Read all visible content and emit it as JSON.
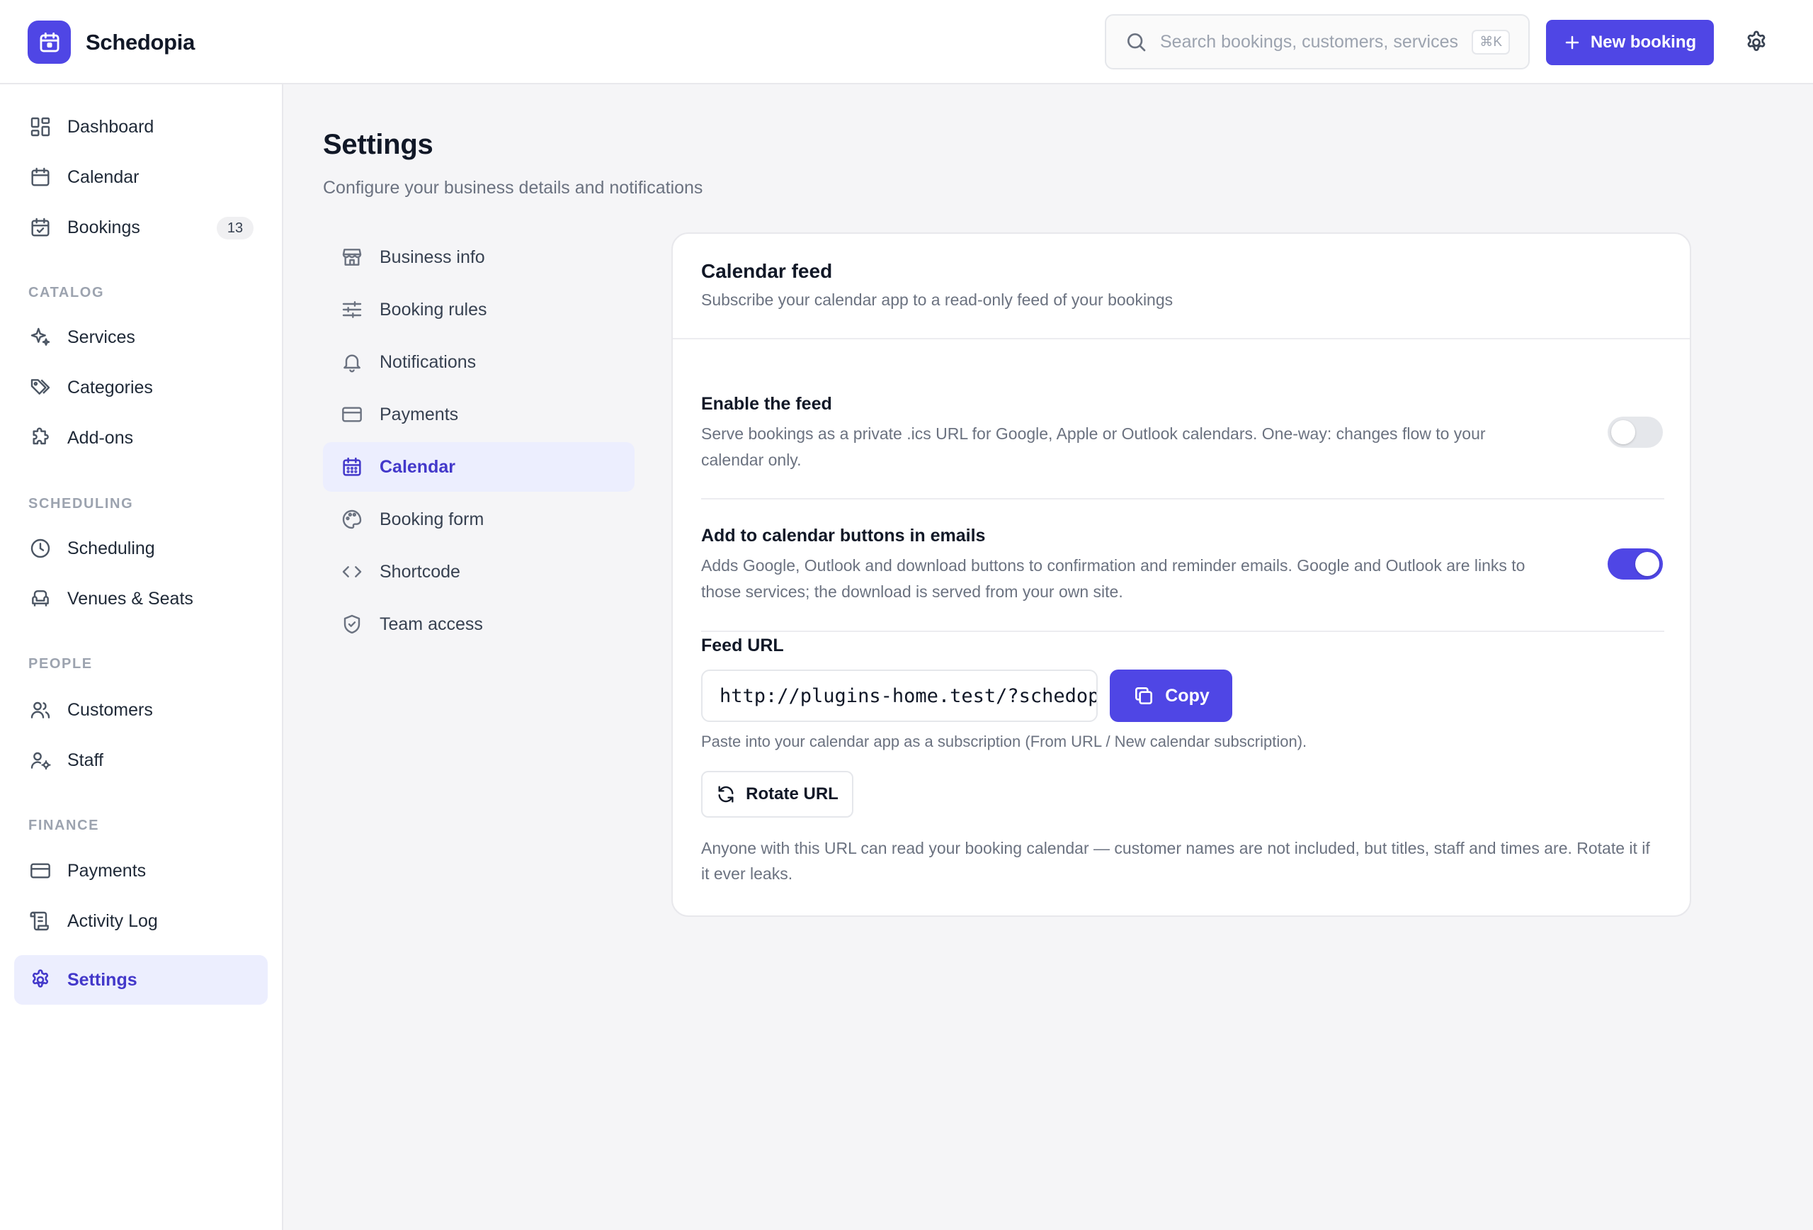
{
  "app": {
    "name": "Schedopia",
    "logo_icon": "calendar-icon"
  },
  "topbar": {
    "search_placeholder": "Search bookings, customers, services",
    "search_shortcut": "⌘K",
    "new_booking_label": "New booking",
    "settings_icon": "gear-icon"
  },
  "sidebar": {
    "items": [
      {
        "label": "Dashboard",
        "icon": "dashboard-icon"
      },
      {
        "label": "Calendar",
        "icon": "calendar-icon"
      },
      {
        "label": "Bookings",
        "icon": "calendar-check-icon",
        "badge": "13"
      }
    ],
    "sections": [
      {
        "title": "CATALOG",
        "items": [
          {
            "label": "Services",
            "icon": "sparkle-icon"
          },
          {
            "label": "Categories",
            "icon": "tags-icon"
          },
          {
            "label": "Add-ons",
            "icon": "puzzle-icon"
          }
        ]
      },
      {
        "title": "SCHEDULING",
        "items": [
          {
            "label": "Scheduling",
            "icon": "clock-icon"
          },
          {
            "label": "Venues & Seats",
            "icon": "armchair-icon"
          }
        ]
      },
      {
        "title": "PEOPLE",
        "items": [
          {
            "label": "Customers",
            "icon": "users-icon"
          },
          {
            "label": "Staff",
            "icon": "user-cog-icon"
          }
        ]
      },
      {
        "title": "FINANCE",
        "items": [
          {
            "label": "Payments",
            "icon": "credit-card-icon"
          },
          {
            "label": "Activity Log",
            "icon": "scroll-icon"
          }
        ]
      }
    ],
    "settings": {
      "label": "Settings",
      "icon": "gear-icon",
      "active": true
    }
  },
  "page": {
    "title": "Settings",
    "subtitle": "Configure your business details and notifications"
  },
  "settings_nav": [
    {
      "label": "Business info",
      "icon": "store-icon"
    },
    {
      "label": "Booking rules",
      "icon": "sliders-icon"
    },
    {
      "label": "Notifications",
      "icon": "bell-icon"
    },
    {
      "label": "Payments",
      "icon": "credit-card-icon"
    },
    {
      "label": "Calendar",
      "icon": "calendar-icon",
      "active": true
    },
    {
      "label": "Booking form",
      "icon": "palette-icon"
    },
    {
      "label": "Shortcode",
      "icon": "code-icon"
    },
    {
      "label": "Team access",
      "icon": "shield-check-icon"
    }
  ],
  "calendar_feed": {
    "title": "Calendar feed",
    "subtitle": "Subscribe your calendar app to a read-only feed of your bookings",
    "enable_feed": {
      "title": "Enable the feed",
      "description": "Serve bookings as a private .ics URL for Google, Apple or Outlook calendars. One-way: changes flow to your calendar only.",
      "enabled": false
    },
    "email_buttons": {
      "title": "Add to calendar buttons in emails",
      "description": "Adds Google, Outlook and download buttons to confirmation and reminder emails. Google and Outlook are links to those services; the download is served from your own site.",
      "enabled": true
    },
    "feed_url": {
      "label": "Feed URL",
      "value": "http://plugins-home.test/?schedop",
      "copy_label": "Copy",
      "hint": "Paste into your calendar app as a subscription (From URL / New calendar subscription).",
      "rotate_label": "Rotate URL",
      "warning": "Anyone with this URL can read your booking calendar — customer names are not included, but titles, staff and times are. Rotate it if it ever leaks."
    }
  },
  "colors": {
    "accent": "#4f46e5",
    "accent_soft": "#eceefe",
    "background": "#f5f5f7",
    "muted_text": "#6b7280"
  }
}
